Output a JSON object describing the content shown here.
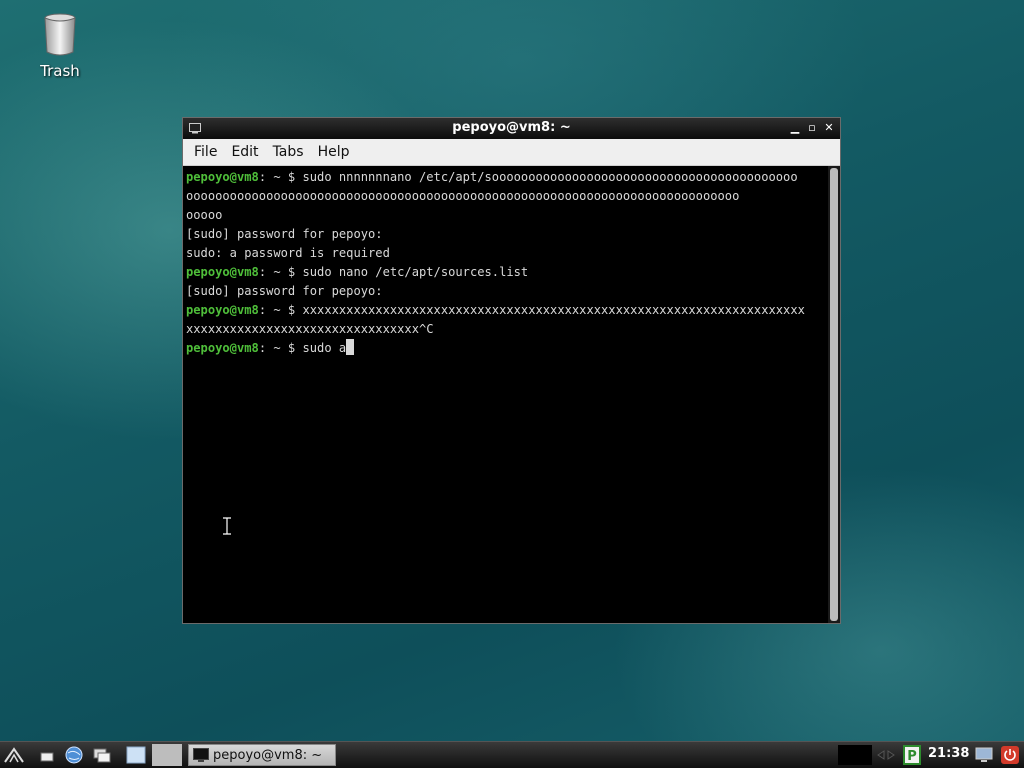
{
  "desktop": {
    "icons": [
      {
        "label": "Trash",
        "icon": "trash-icon"
      }
    ]
  },
  "window": {
    "title": "pepoyo@vm8: ~",
    "menu": [
      "File",
      "Edit",
      "Tabs",
      "Help"
    ]
  },
  "terminal": {
    "prompt": "pepoyo@vm8",
    "prompt_suffix": ": ~ $ ",
    "lines": [
      {
        "prompt": true,
        "text": "sudo nnnnnnnano /etc/apt/soooooooooooooooooooooooooooooooooooooooooo"
      },
      {
        "prompt": false,
        "text": "oooooooooooooooooooooooooooooooooooooooooooooooooooooooooooooooooooooooooooo"
      },
      {
        "prompt": false,
        "text": "ooooo"
      },
      {
        "prompt": false,
        "text": "[sudo] password for pepoyo:"
      },
      {
        "prompt": false,
        "text": "sudo: a password is required"
      },
      {
        "prompt": true,
        "text": "sudo nano /etc/apt/sources.list"
      },
      {
        "prompt": false,
        "text": "[sudo] password for pepoyo:"
      },
      {
        "prompt": true,
        "text": "xxxxxxxxxxxxxxxxxxxxxxxxxxxxxxxxxxxxxxxxxxxxxxxxxxxxxxxxxxxxxxxxxxxxx"
      },
      {
        "prompt": false,
        "text": "xxxxxxxxxxxxxxxxxxxxxxxxxxxxxxxx^C"
      },
      {
        "prompt": true,
        "text": "sudo a"
      }
    ]
  },
  "taskbar": {
    "task_label": "pepoyo@vm8: ~",
    "clock": "21:38"
  },
  "colors": {
    "prompt": "#4fbf3a",
    "terminal_bg": "#000000",
    "text": "#d9d9d9"
  }
}
